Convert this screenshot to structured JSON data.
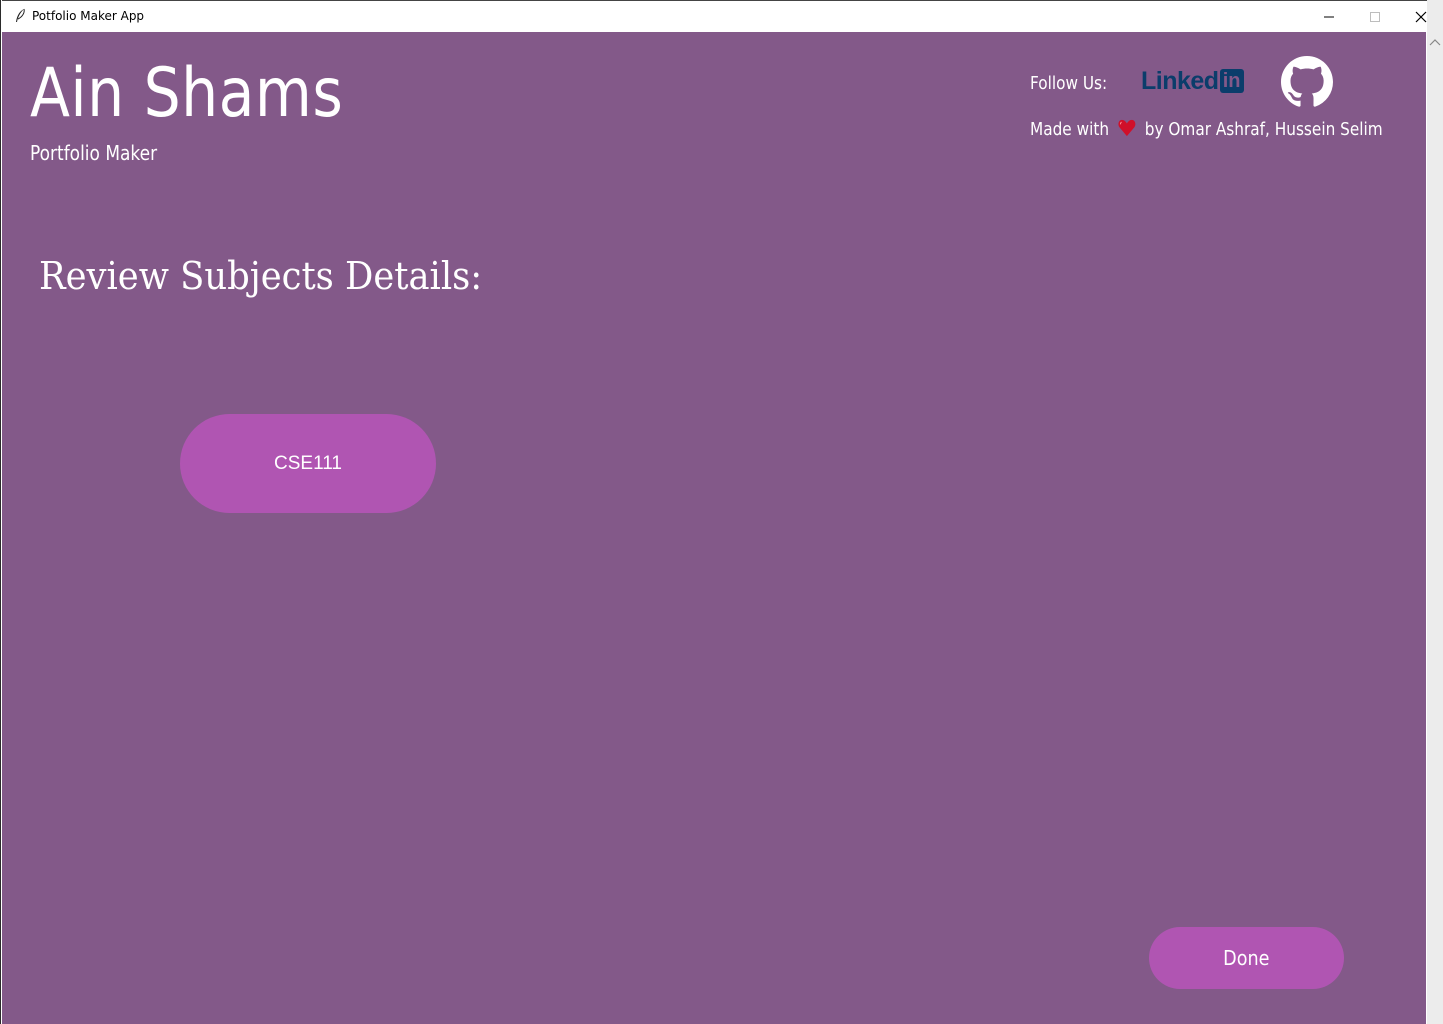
{
  "window": {
    "title": "Potfolio Maker App"
  },
  "header": {
    "brand_title": "Ain Shams",
    "brand_subtitle": "Portfolio Maker",
    "follow_label": "Follow Us:",
    "linkedin_text": "Linked",
    "linkedin_in": "in",
    "made_with_prefix": "Made with",
    "made_with_suffix": "by Omar Ashraf, Hussein Selim"
  },
  "main": {
    "section_title": "Review Subjects Details:",
    "subjects": [
      "CSE111"
    ],
    "done_label": "Done"
  },
  "colors": {
    "background": "#835989",
    "button": "#b055b2",
    "linkedin": "#0b3d6b",
    "heart": "#d0102a"
  },
  "icons": [
    "feather-icon",
    "minimize-icon",
    "maximize-icon",
    "close-icon",
    "linkedin-icon",
    "github-icon",
    "heart-icon"
  ]
}
